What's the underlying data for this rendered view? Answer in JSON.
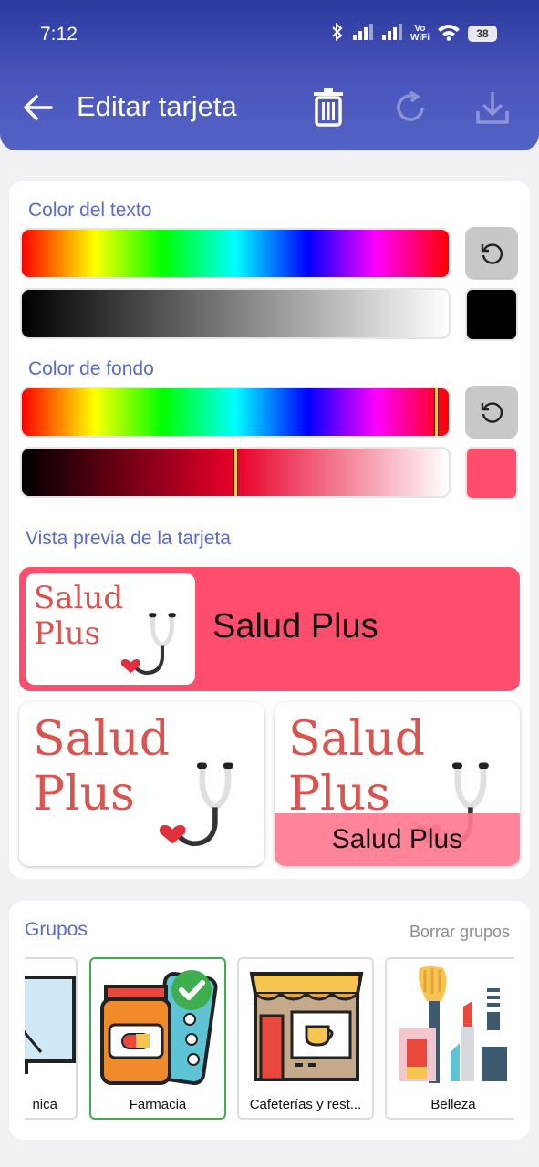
{
  "status": {
    "time": "7:12",
    "vowifi_top": "Vo",
    "vowifi_bottom": "WiFi",
    "battery": "38"
  },
  "header": {
    "title": "Editar tarjeta",
    "icons": [
      "back-arrow-icon",
      "trash-icon",
      "refresh-icon",
      "download-icon"
    ]
  },
  "editor": {
    "text_color_label": "Color del texto",
    "bg_color_label": "Color de fondo",
    "text_color": "#000000",
    "bg_color": "#ff4d6d"
  },
  "preview": {
    "label": "Vista previa de la tarjeta",
    "logo_line1": "Salud",
    "logo_line2": "Plus",
    "card_name": "Salud Plus"
  },
  "groups": {
    "title": "Grupos",
    "clear_label": "Borrar grupos",
    "items": [
      {
        "label": "nica",
        "icon": "screen-icon",
        "selected": false
      },
      {
        "label": "Farmacia",
        "icon": "pharmacy-icon",
        "selected": true
      },
      {
        "label": "Cafeterías y rest...",
        "icon": "cafe-icon",
        "selected": false
      },
      {
        "label": "Belleza",
        "icon": "makeup-icon",
        "selected": false
      }
    ]
  }
}
